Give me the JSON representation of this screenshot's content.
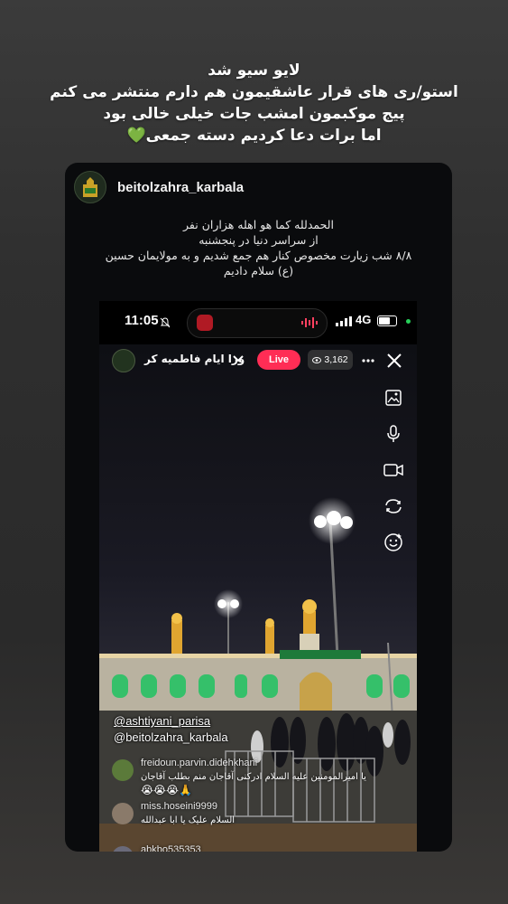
{
  "story": {
    "lines": [
      "لایو سیو شد",
      "استو/ری های قرار عاشقیمون هم دارم منتشر می کنم",
      "پیج موکبمون امشب جات خیلی خالی بود",
      "اما برات دعا کردیم دسته جمعی💚"
    ]
  },
  "post": {
    "username": "beitolzahra_karbala",
    "caption_lines": [
      "الحمدلله کما هو اهله هزاران نفر",
      "از سراسر دنیا در پنجشنبه",
      "۸/۸ شب زیارت مخصوص کنار هم جمع شدیم و به مولایمان حسین",
      "(ع) سلام دادیم"
    ]
  },
  "phone": {
    "time": "11:05",
    "network": "4G"
  },
  "live": {
    "title": "ورا ایام فاطمیه کر",
    "badge": "Live",
    "viewer_count": "3,162",
    "tools": [
      "image-icon",
      "microphone-icon",
      "video-camera-icon",
      "switch-camera-icon",
      "effects-icon"
    ],
    "handles": [
      "@ashtiyani_parisa",
      "@beitolzahra_karbala"
    ],
    "comments": [
      {
        "user": "freidoun.parvin.didehkhani",
        "text": "یا امیرالمومنین علیه السلام ادرکنی آقاجان منم بطلب آقاجان",
        "emoji": "🙏😭😭😭",
        "avatar_color": "#5b7a3a"
      },
      {
        "user": "miss.hoseini9999",
        "text": "السلام علیک یا ابا عبدالله",
        "emoji": "",
        "avatar_color": "#8a7a6a"
      },
      {
        "user": "abkbo535353",
        "text": "",
        "emoji": "",
        "avatar_color": "#6a6a7a"
      }
    ]
  },
  "colors": {
    "live_badge": "#ff2d55",
    "card_bg": "#0a0b0d",
    "accent_green": "#27d05a"
  }
}
